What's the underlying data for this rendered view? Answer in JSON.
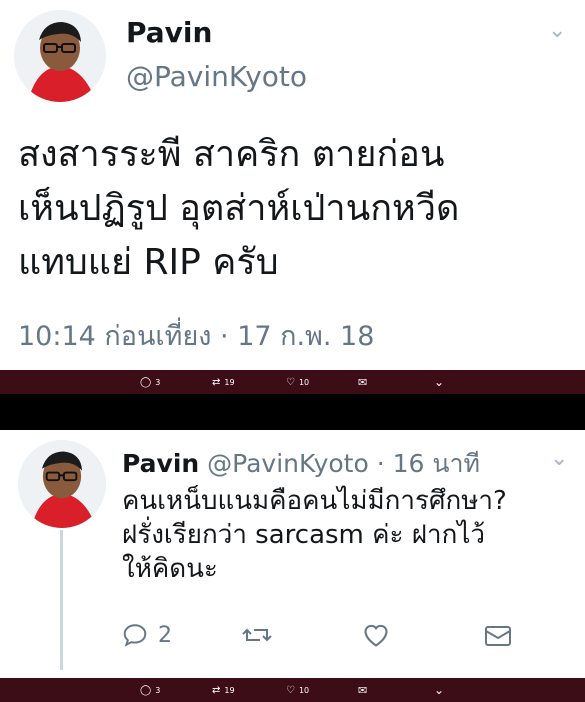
{
  "tweet1": {
    "name": "Pavin",
    "handle": "@PavinKyoto",
    "text_line1": "สงสารระพี สาคริก ตายก่อน",
    "text_line2": "เห็นปฏิรูป อุตส่าห์เป่านกหวีด",
    "text_line3": "แทบแย่ RIP ครับ",
    "timestamp": "10:14 ก่อนเที่ยง · 17 ก.พ. 18",
    "bar_counts": {
      "replies": "3",
      "retweets": "19",
      "likes": "10"
    }
  },
  "tweet2": {
    "name": "Pavin",
    "handle": "@PavinKyoto",
    "time": "· 16 นาที",
    "text_line1": "คนเหน็บแนมคือคนไม่มีการศึกษา?",
    "text_line2": "ฝรั่งเรียกว่า sarcasm ค่ะ ฝากไว้",
    "text_line3": "ให้คิดนะ",
    "reply_count": "2"
  },
  "bottom_bar": {
    "replies": "3",
    "retweets": "19",
    "likes": "10"
  },
  "colors": {
    "dark_bar": "#3c0d16",
    "avatar_shirt": "#d81f2a"
  }
}
